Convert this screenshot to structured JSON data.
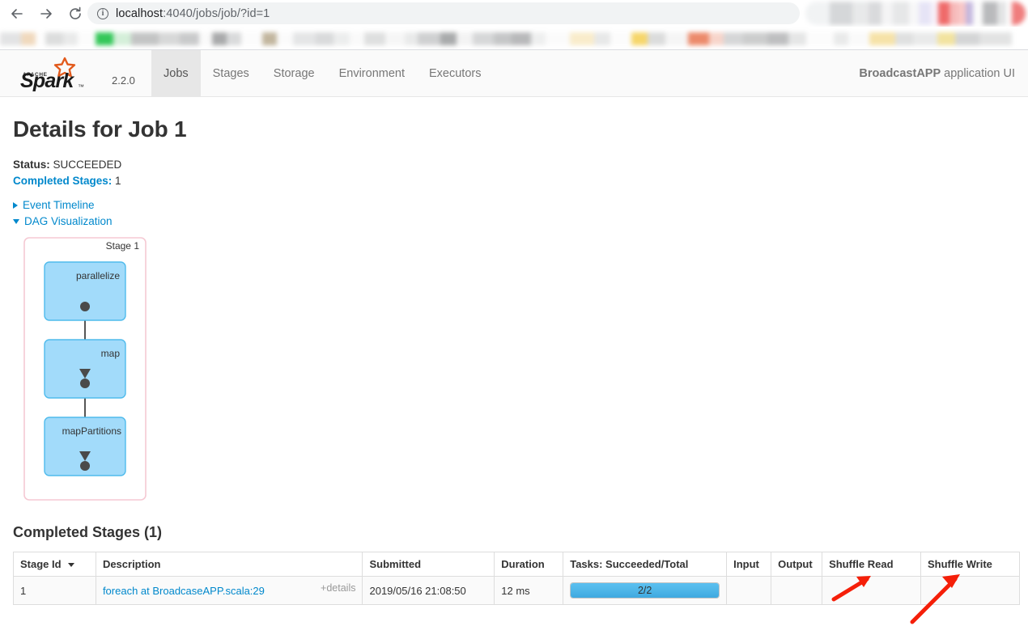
{
  "browser": {
    "back_icon": "back-arrow-icon",
    "forward_icon": "forward-arrow-icon",
    "reload_icon": "reload-icon",
    "info_icon": "info-circle-icon",
    "url_prefix": "localhost",
    "url_suffix": ":4040/jobs/job/?id=1",
    "url_full": "localhost:4040/jobs/job/?id=1"
  },
  "navbar": {
    "brand_top": "APACHE",
    "brand_name": "Spark",
    "version": "2.2.0",
    "tabs": [
      {
        "label": "Jobs",
        "active": true
      },
      {
        "label": "Stages",
        "active": false
      },
      {
        "label": "Storage",
        "active": false
      },
      {
        "label": "Environment",
        "active": false
      },
      {
        "label": "Executors",
        "active": false
      }
    ],
    "app_name": "BroadcastAPP",
    "app_suffix": "application UI"
  },
  "page": {
    "title": "Details for Job 1",
    "status_key": "Status:",
    "status_value": "SUCCEEDED",
    "completed_stages_key": "Completed Stages:",
    "completed_stages_value": "1",
    "event_timeline_label": "Event Timeline",
    "dag_label": "DAG Visualization"
  },
  "dag": {
    "stage_label": "Stage 1",
    "nodes": [
      {
        "label": "parallelize"
      },
      {
        "label": "map"
      },
      {
        "label": "mapPartitions"
      }
    ],
    "colors": {
      "stage_border": "#f5c9d3",
      "node_fill": "#a2dbfa",
      "node_border": "#4fbbec",
      "edge": "#444444"
    }
  },
  "stages_section": {
    "heading": "Completed Stages (1)",
    "columns": [
      "Stage Id",
      "Description",
      "Submitted",
      "Duration",
      "Tasks: Succeeded/Total",
      "Input",
      "Output",
      "Shuffle Read",
      "Shuffle Write"
    ],
    "rows": [
      {
        "stage_id": "1",
        "description": "foreach at BroadcaseAPP.scala:29",
        "details_label": "+details",
        "submitted": "2019/05/16 21:08:50",
        "duration": "12 ms",
        "tasks_label": "2/2",
        "tasks_percent": 100,
        "input": "",
        "output": "",
        "shuffle_read": "",
        "shuffle_write": ""
      }
    ]
  },
  "annotations": {
    "arrow_color": "#f51f09",
    "arrows": [
      {
        "name": "arrow-shuffle-read"
      },
      {
        "name": "arrow-shuffle-write"
      }
    ]
  }
}
